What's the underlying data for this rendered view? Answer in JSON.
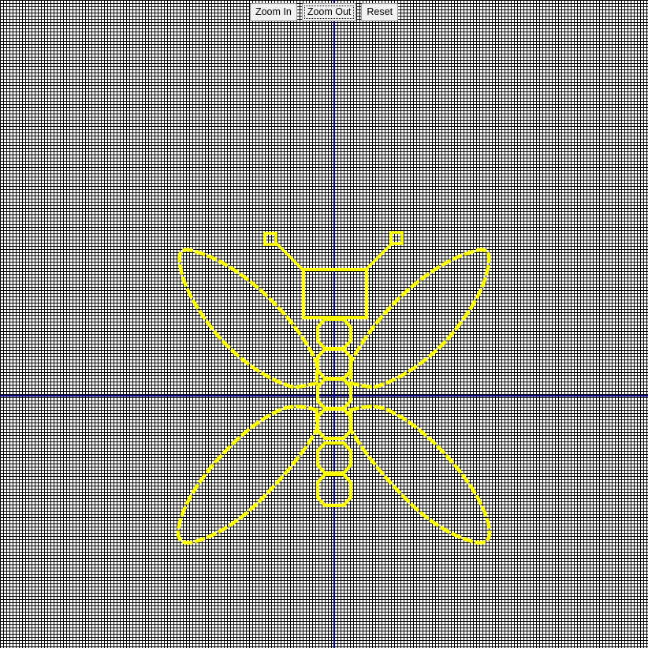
{
  "toolbar": {
    "zoom_in_label": "Zoom In",
    "zoom_out_label": "Zoom Out",
    "reset_label": "Reset"
  },
  "canvas": {
    "background_color": "#ffffff",
    "grid_color": "#000000",
    "axis_color": "#000080",
    "drawing_color": "#ffff00",
    "grid_visible": true
  }
}
